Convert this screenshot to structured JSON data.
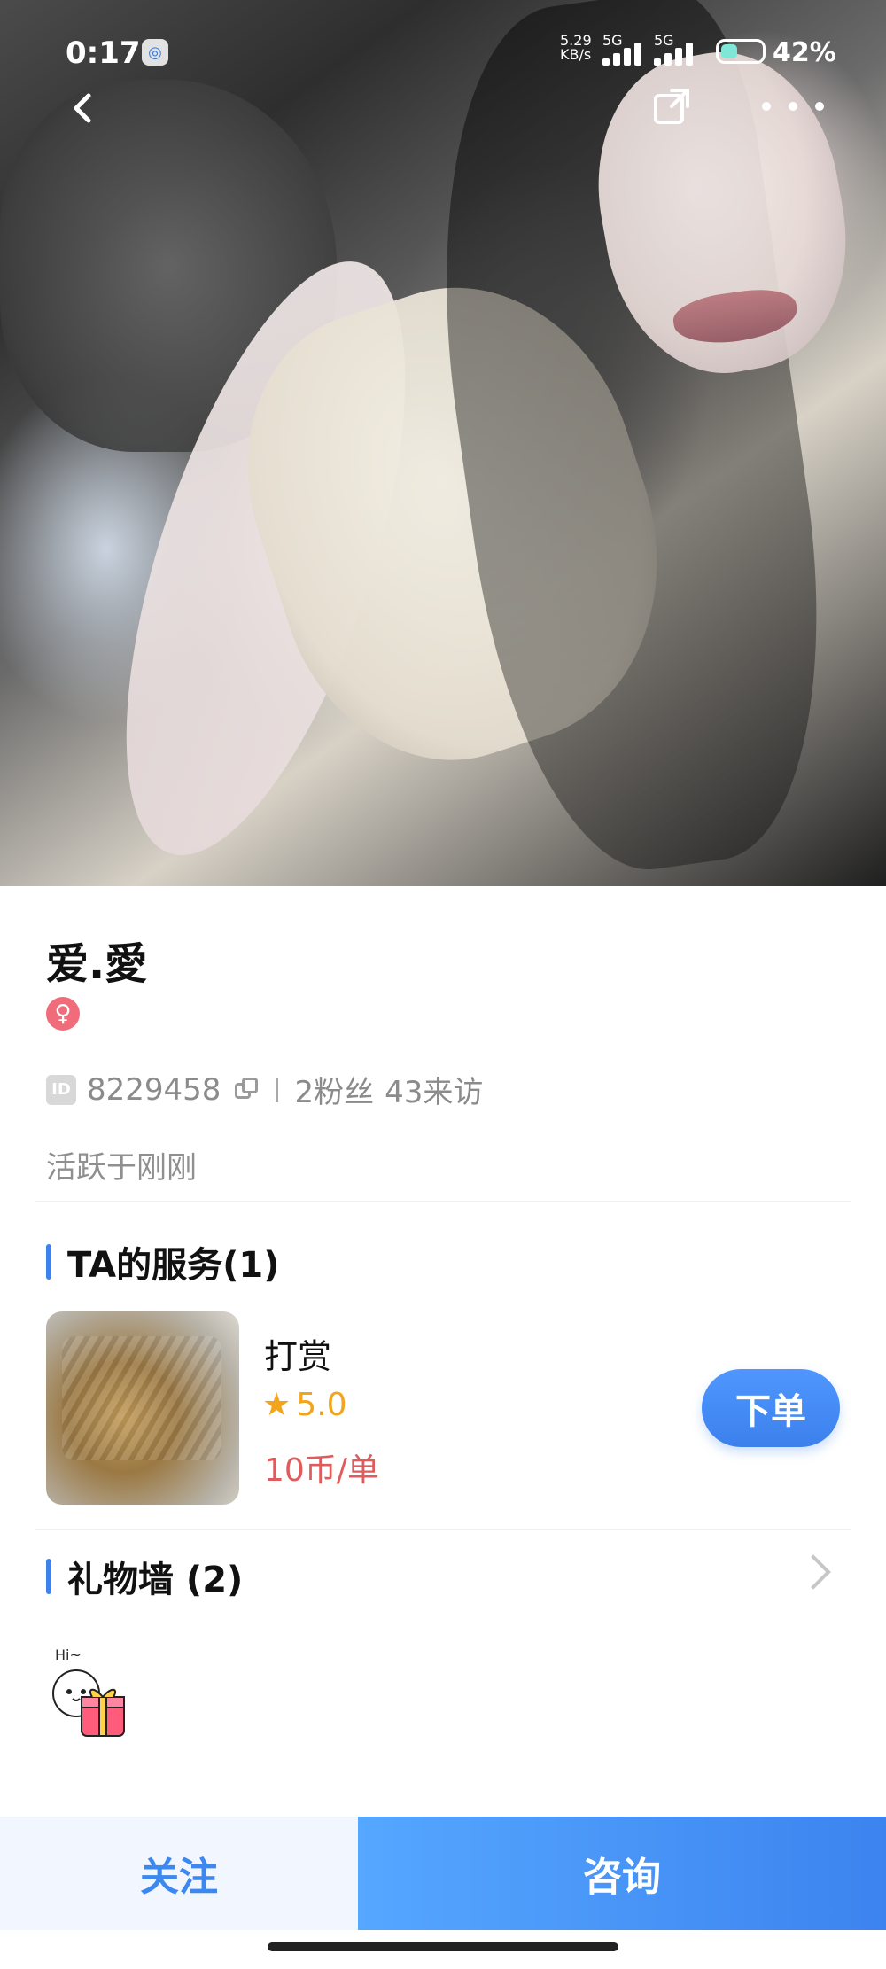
{
  "status_bar": {
    "time": "0:17",
    "network_speed_value": "5.29",
    "network_speed_unit": "KB/s",
    "signal_label_1": "5G",
    "signal_label_2": "5G",
    "battery": "42%"
  },
  "profile": {
    "name": "爱.愛",
    "gender_symbol": "♀",
    "id_label": "ID",
    "id": "8229458",
    "fans": "2粉丝",
    "visitors": "43来访",
    "active_status": "活跃于刚刚"
  },
  "services": {
    "title": "TA的服务(1)",
    "items": [
      {
        "name": "打赏",
        "rating_star": "★",
        "rating": "5.0",
        "price": "10币/单",
        "button_label": "下单"
      }
    ]
  },
  "gift_wall": {
    "title": "礼物墙 (2)",
    "sticker_text": "Hi~"
  },
  "bottom_actions": {
    "follow": "关注",
    "consult": "咨询"
  },
  "colors": {
    "accent": "#3C83EF",
    "price": "#E05C5C",
    "rating": "#F2A51A",
    "gender": "#F06C7A"
  },
  "icons": {
    "back": "chevron-left-icon",
    "share": "share-icon",
    "more": "more-icon",
    "copy": "copy-icon",
    "arrow": "chevron-right-icon"
  }
}
